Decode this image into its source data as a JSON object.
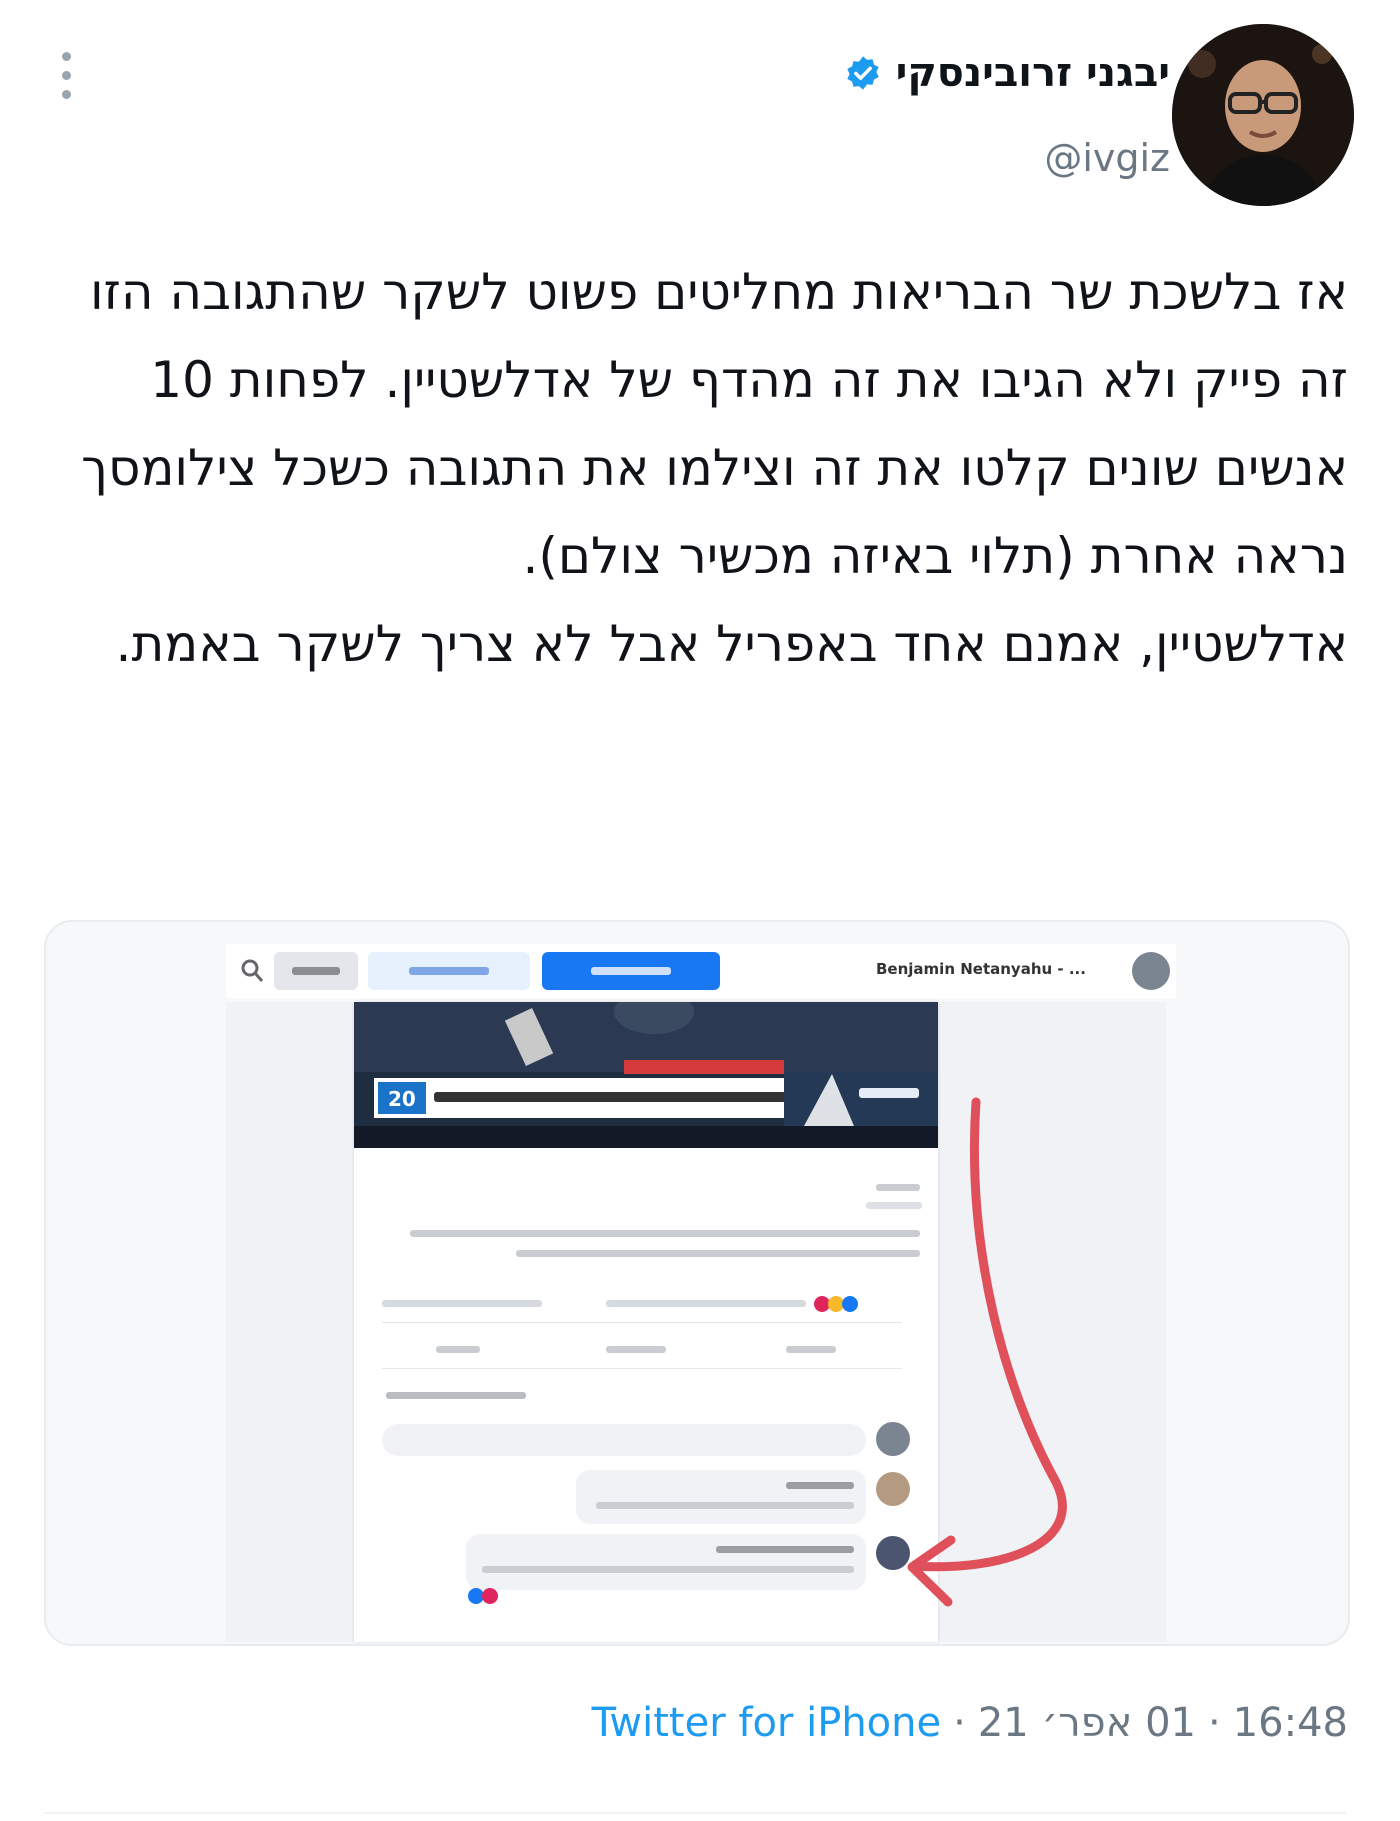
{
  "author": {
    "display_name": "יבגני זרובינסקי",
    "handle": "@ivgiz",
    "verified": true
  },
  "tweet": {
    "paragraphs": [
      "אז בלשכת שר הבריאות מחליטים פשוט לשקר שהתגובה הזו זה פייק ולא הגיבו את זה מהדף של אדלשטיין. לפחות 10 אנשים שונים קלטו את זה וצילמו את התגובה כשכל צילומסך נראה אחרת (תלוי באיזה מכשיר צולם).",
      "אדלשטיין, אמנם אחד באפריל אבל לא צריך לשקר באמת."
    ]
  },
  "media": {
    "post_author": "Benjamin Netanyahu - ...",
    "arrow_color": "#e0505a"
  },
  "footer": {
    "time": "16:48",
    "date": "01 אפר׳ 21",
    "separator": "·",
    "source": "Twitter for iPhone"
  },
  "colors": {
    "accent": "#1d9bf0",
    "verified": "#1d9bf0",
    "muted": "#6b7783"
  }
}
